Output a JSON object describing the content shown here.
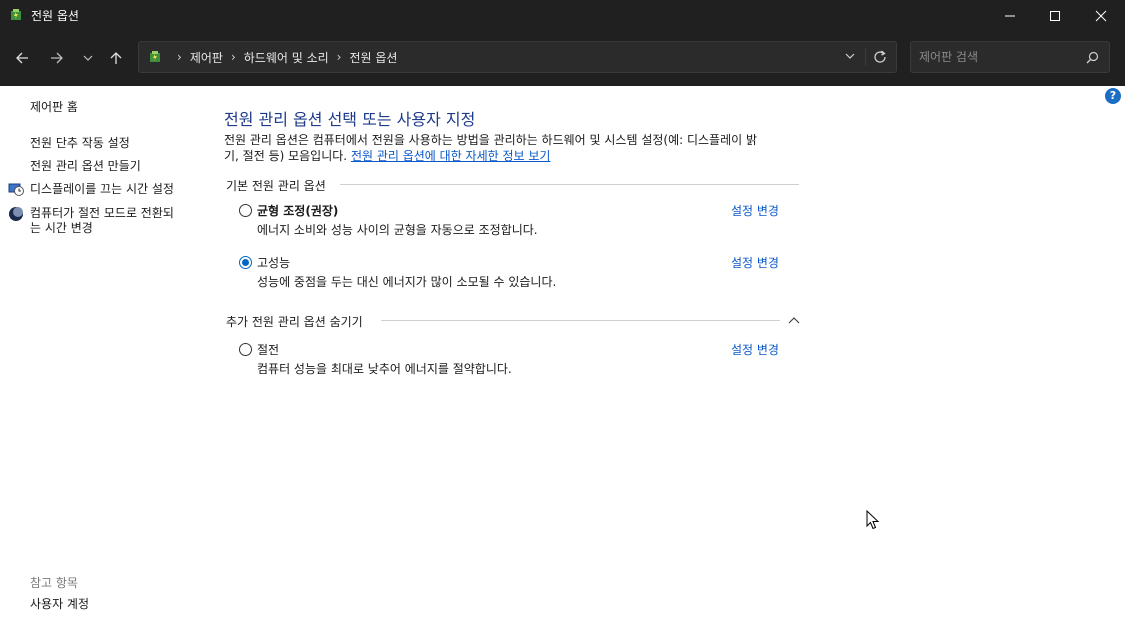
{
  "window": {
    "title": "전원 옵션",
    "icon": "power-options-icon"
  },
  "nav": {
    "back_icon": "arrow-left-icon",
    "forward_icon": "arrow-right-icon",
    "recent_icon": "chevron-down-icon",
    "up_icon": "arrow-up-icon"
  },
  "address": {
    "crumbs": [
      "제어판",
      "하드웨어 및 소리",
      "전원 옵션"
    ]
  },
  "search": {
    "placeholder": "제어판 검색"
  },
  "sidebar": {
    "home": "제어판 홈",
    "items": [
      {
        "label": "전원 단추 작동 설정"
      },
      {
        "label": "전원 관리 옵션 만들기"
      },
      {
        "label": "디스플레이를 끄는 시간 설정",
        "icon": "display-clock-icon"
      },
      {
        "label_line1": "컴퓨터가 절전 모드로 전환되",
        "label_line2": "는 시간 변경",
        "icon": "moon-sleep-icon"
      }
    ],
    "see_also_title": "참고 항목",
    "see_also_items": [
      "사용자 계정"
    ]
  },
  "main": {
    "heading": "전원 관리 옵션 선택 또는 사용자 지정",
    "desc_line1": "전원 관리 옵션은 컴퓨터에서 전원을 사용하는 방법을 관리하는 하드웨어 및 시스템 설정(예: 디스플레이 밝",
    "desc_line2_prefix": "기, 절전 등) 모음입니다. ",
    "desc_link": "전원 관리 옵션에 대한 자세한 정보 보기",
    "basic_group": "기본 전원 관리 옵션",
    "extra_group": "추가 전원 관리 옵션 숨기기",
    "change_link": "설정 변경",
    "plans": [
      {
        "name": "균형 조정(권장)",
        "desc": "에너지 소비와 성능 사이의 균형을 자동으로 조정합니다.",
        "selected": false
      },
      {
        "name": "고성능",
        "desc": "성능에 중점을 두는 대신 에너지가 많이 소모될 수 있습니다.",
        "selected": true
      },
      {
        "name": "절전",
        "desc": "컴퓨터 성능을 최대로 낮추어 에너지를 절약합니다.",
        "selected": false
      }
    ]
  },
  "colors": {
    "titlebar": "#202020",
    "heading": "#1e3a8a",
    "link": "#0a58ca",
    "radio_selected": "#0067c0"
  }
}
